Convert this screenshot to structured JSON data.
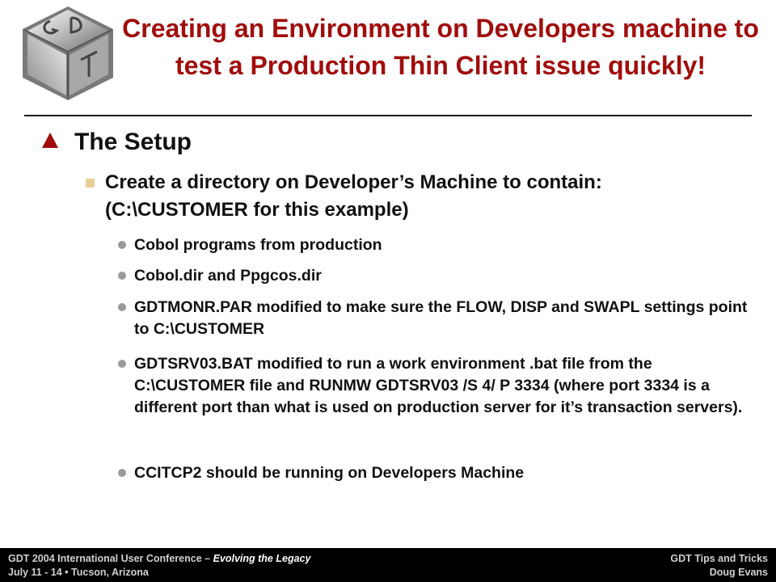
{
  "header": {
    "logo_icon": "gdt-cube-logo-icon",
    "title": "Creating an Environment on Developers machine to test a Production Thin Client issue quickly!"
  },
  "content": {
    "heading": "The Setup",
    "subheading_line1": "Create a directory on Developer’s Machine to contain:",
    "subheading_line2": "(C:\\CUSTOMER for this example)",
    "items": [
      "Cobol programs from production",
      "Cobol.dir and Ppgcos.dir",
      "GDTMONR.PAR modified to make sure the FLOW, DISP and SWAPL settings point to C:\\CUSTOMER",
      "GDTSRV03.BAT modified to run a work environment .bat file from the C:\\CUSTOMER file and RUNMW GDTSRV03 /S 4/ P 3334 (where port 3334 is a different port than what is used on production server for it’s transaction servers).",
      "CCITCP2 should be running on Developers Machine"
    ]
  },
  "footer": {
    "left_line1_a": "GDT 2004 International User Conference – ",
    "left_line1_b": "Evolving the Legacy",
    "left_line2": "July 11 - 14  •  Tucson, Arizona",
    "right_line1": "GDT Tips and Tricks",
    "right_line2": "Doug Evans"
  },
  "colors": {
    "title": "#a10d0d",
    "heading_bullet": "#a10d0d",
    "sub_bullet": "#e6cf99",
    "item_bullet": "#9a9a9a",
    "footer_bg": "#000000"
  }
}
